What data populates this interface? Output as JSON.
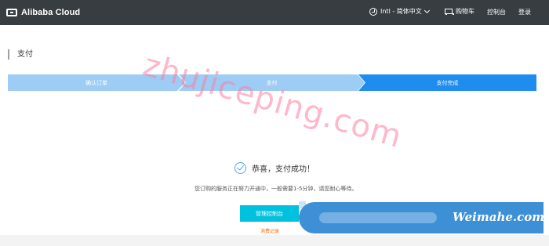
{
  "header": {
    "logo_text": "Alibaba Cloud",
    "language_label": "Intl - 简体中文",
    "cart_label": "购物车",
    "console_label": "控制台",
    "login_label": "登录"
  },
  "page": {
    "title": "支付"
  },
  "steps": [
    {
      "label": "确认订单",
      "state": "completed"
    },
    {
      "label": "支付",
      "state": "completed"
    },
    {
      "label": "支付完成",
      "state": "current"
    }
  ],
  "result": {
    "message": "恭喜，支付成功！",
    "description": "您订购的服务正在努力开通中，一般需要1-5分钟，请您耐心等待。",
    "console_button_label": "管理控制台",
    "records_link_label": "消费记录"
  },
  "overlays": {
    "watermark_text": "zhujiceping.com",
    "promo_text": "Weimahe.com"
  },
  "colors": {
    "topbar": "#373d41",
    "step_done": "#9dccf5",
    "step_current": "#1f8cf0",
    "primary_button": "#00c1de",
    "link": "#ff6a00"
  }
}
